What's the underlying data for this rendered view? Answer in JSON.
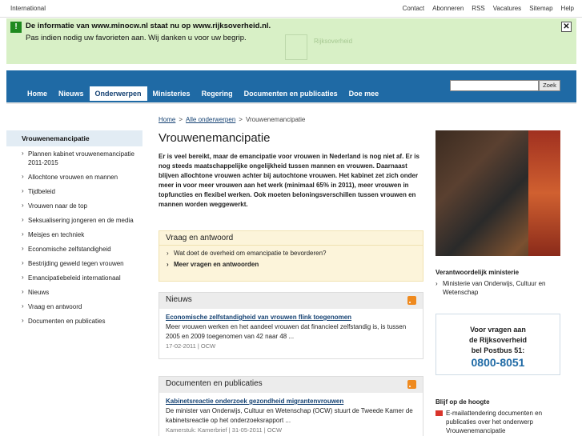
{
  "topbar": {
    "left": "International",
    "links": [
      "Contact",
      "Abonneren",
      "RSS",
      "Vacatures",
      "Sitemap",
      "Help"
    ]
  },
  "notice": {
    "line1": "De informatie van www.minocw.nl staat nu op www.rijksoverheid.nl.",
    "line2": "Pas indien nodig uw favorieten aan. Wij danken u voor uw begrip.",
    "close": "✕"
  },
  "logo_text": "Rijksoverheid",
  "search": {
    "button": "Zoek",
    "value": ""
  },
  "nav": [
    "Home",
    "Nieuws",
    "Onderwerpen",
    "Ministeries",
    "Regering",
    "Documenten en publicaties",
    "Doe mee"
  ],
  "sidebar": {
    "current": "Vrouwenemancipatie",
    "items": [
      "Plannen kabinet vrouwenemancipatie 2011-2015",
      "Allochtone vrouwen en mannen",
      "Tijdbeleid",
      "Vrouwen naar de top",
      "Seksualisering jongeren en de media",
      "Meisjes en techniek",
      "Economische zelfstandigheid",
      "Bestrijding geweld tegen vrouwen",
      "Emancipatiebeleid internationaal",
      "Nieuws",
      "Vraag en antwoord",
      "Documenten en publicaties"
    ]
  },
  "breadcrumb": {
    "home": "Home",
    "sep": ">",
    "all": "Alle onderwerpen",
    "current": "Vrouwenemancipatie"
  },
  "page_title": "Vrouwenemancipatie",
  "intro": "Er is veel bereikt, maar de emancipatie voor vrouwen in Nederland is nog niet af. Er is nog steeds maatschappelijke ongelijkheid tussen mannen en vrouwen. Daarnaast blijven allochtone vrouwen achter bij autochtone vrouwen. Het kabinet zet zich onder meer in voor meer vrouwen aan het werk (minimaal 65% in 2011), meer vrouwen in topfuncties en flexibel werken. Ook moeten beloningsverschillen tussen vrouwen en mannen worden weggewerkt.",
  "qa": {
    "title": "Vraag en antwoord",
    "question": "Wat doet de overheid om emancipatie te bevorderen?",
    "more": "Meer vragen en antwoorden"
  },
  "news": {
    "title": "Nieuws",
    "item_title": "Economische zelfstandigheid van vrouwen flink toegenomen",
    "item_text": "Meer vrouwen werken en het aandeel vrouwen dat financieel zelfstandig is, is tussen 2005 en 2009 toegenomen van 42 naar 48 ...",
    "item_meta": "17-02-2011 | OCW"
  },
  "docs": {
    "title": "Documenten en publicaties",
    "item_title": "Kabinetsreactie onderzoek gezondheid migrantenvrouwen",
    "item_text": "De minister van Onderwijs, Cultuur en Wetenschap (OCW) stuurt de Tweede Kamer de kabinetsreactie op het onderzoeksrapport ...",
    "item_meta": "Kamerstuk: Kamerbrief | 31-05-2011 | OCW"
  },
  "ministry": {
    "title": "Verantwoordelijk ministerie",
    "link": "Ministerie van Onderwijs, Cultuur en Wetenschap"
  },
  "postbus": {
    "line1": "Voor vragen aan",
    "line2": "de Rijksoverheid",
    "line3": "bel Postbus 51:",
    "phone": "0800-8051"
  },
  "updates": {
    "title": "Blijf op de hoogte",
    "link": "E-mailattendering documenten en publicaties over het onderwerp Vrouwenemancipatie"
  },
  "colors": {
    "brand_blue": "#1f6aa5",
    "notice_green": "#d8f0c6",
    "rss_orange": "#ef8a1f"
  }
}
